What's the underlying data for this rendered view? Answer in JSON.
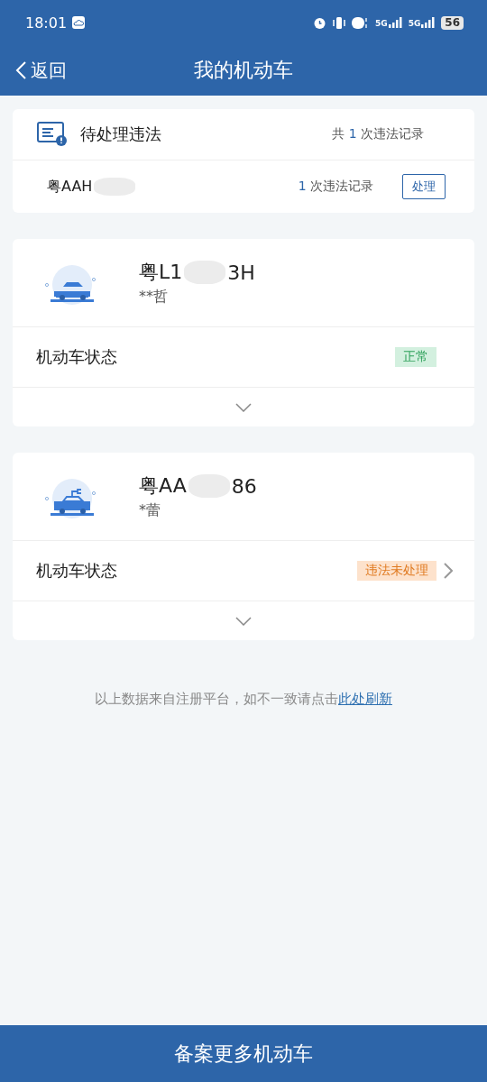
{
  "status_bar": {
    "time": "18:01",
    "battery": "56",
    "network_1": "5G",
    "network_2": "5G"
  },
  "nav": {
    "back": "返回",
    "title": "我的机动车"
  },
  "pending": {
    "title": "待处理违法",
    "summary_prefix": "共",
    "summary_count": "1",
    "summary_suffix": "次违法记录",
    "items": [
      {
        "plate_parts": [
          "粤AAH"
        ],
        "count": "1",
        "count_suffix": "次违法记录",
        "action": "处理"
      }
    ]
  },
  "vehicles": [
    {
      "kind": "sedan",
      "plate_parts": [
        "粤L1",
        "3H"
      ],
      "owner": "**哲",
      "status_label": "机动车状态",
      "status": {
        "text": "正常",
        "kind": "normal"
      },
      "has_arrow": false
    },
    {
      "kind": "electric",
      "plate_parts": [
        "粤AA",
        "86"
      ],
      "owner": "*蕾",
      "status_label": "机动车状态",
      "status": {
        "text": "违法未处理",
        "kind": "violation"
      },
      "has_arrow": true
    }
  ],
  "note": {
    "text": "以上数据来自注册平台，如不一致请点击",
    "link": "此处刷新"
  },
  "bottom_button": "备案更多机动车"
}
